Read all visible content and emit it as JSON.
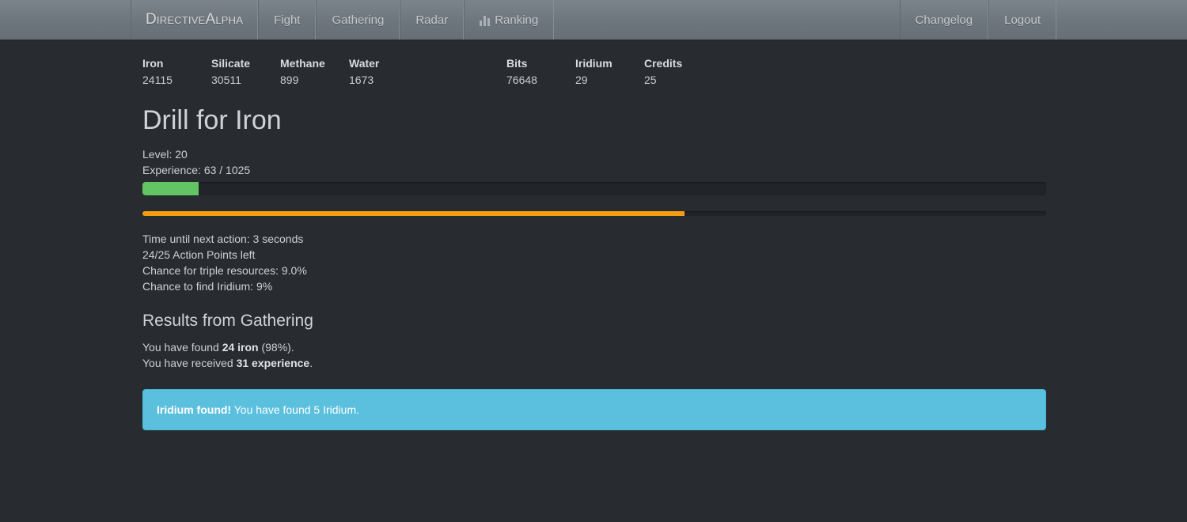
{
  "navbar": {
    "brand": "DirectiveAlpha",
    "left_items": [
      {
        "label": "Fight",
        "icon": ""
      },
      {
        "label": "Gathering",
        "icon": ""
      },
      {
        "label": "Radar",
        "icon": ""
      },
      {
        "label": "Ranking",
        "icon": "bar-chart-icon"
      }
    ],
    "right_items": [
      {
        "label": "Changelog"
      },
      {
        "label": "Logout"
      }
    ]
  },
  "resources": {
    "primary": [
      {
        "name": "Iron",
        "value": "24115"
      },
      {
        "name": "Silicate",
        "value": "30511"
      },
      {
        "name": "Methane",
        "value": "899"
      },
      {
        "name": "Water",
        "value": "1673"
      }
    ],
    "secondary": [
      {
        "name": "Bits",
        "value": "76648"
      },
      {
        "name": "Iridium",
        "value": "29"
      },
      {
        "name": "Credits",
        "value": "25"
      }
    ]
  },
  "page": {
    "title": "Drill for Iron",
    "level_line": "Level: 20",
    "experience_line": "Experience: 63 / 1025"
  },
  "progress": {
    "experience": {
      "percent": 6.2,
      "color": "#62c462"
    },
    "timer": {
      "percent": 60.0,
      "color": "#f59c13"
    }
  },
  "status": {
    "lines": [
      "Time until next action: 3 seconds",
      "24/25 Action Points left",
      "Chance for triple resources: 9.0%",
      "Chance to find Iridium: 9%"
    ]
  },
  "results": {
    "heading": "Results from Gathering",
    "found_prefix": "You have found ",
    "found_amount": "24 iron",
    "found_suffix": " (98%).",
    "received_prefix": "You have received ",
    "received_amount": "31 experience",
    "received_suffix": "."
  },
  "alert": {
    "title": "Iridium found!",
    "message": " You have found 5 Iridium.",
    "color": "#5bc0de"
  }
}
